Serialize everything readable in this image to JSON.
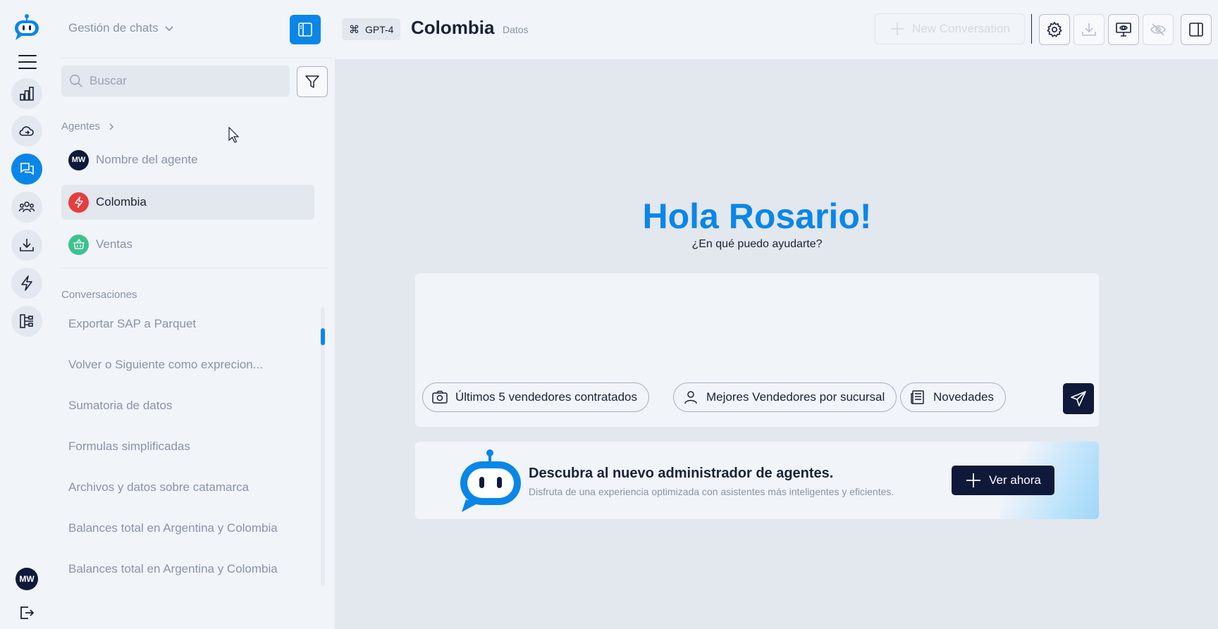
{
  "rail": {
    "avatar_initials": "MW",
    "icons": [
      "dashboard-icon",
      "cloud-sync-icon",
      "chats-icon",
      "team-icon",
      "download-icon",
      "lightning-icon",
      "workflow-icon"
    ]
  },
  "sidebar": {
    "title": "Gestión de chats",
    "search_placeholder": "Buscar",
    "agents_label": "Agentes",
    "agents": [
      {
        "name": "Nombre del agente",
        "initials": "MW",
        "color": "#0f1a3a"
      },
      {
        "name": "Colombia",
        "color": "#e53e3e"
      },
      {
        "name": "Ventas",
        "color": "#3ec28f"
      }
    ],
    "conversations_label": "Conversaciones",
    "conversations": [
      "Exportar SAP a Parquet",
      "Volver o Siguiente como exprecion...",
      "Sumatoria de datos",
      "Formulas simplificadas",
      "Archivos y datos sobre catamarca",
      "Balances total en Argentina y Colombia",
      "Balances total en Argentina y Colombia"
    ]
  },
  "topbar": {
    "model": "GPT-4",
    "agent_title": "Colombia",
    "agent_subtitle": "Datos",
    "new_conversation": "New Conversation"
  },
  "main": {
    "greeting": "Hola Rosario!",
    "subtitle": "¿En qué puedo ayudarte?",
    "composer_value": "",
    "chips": [
      "Últimos 5  vendedores contratados",
      "Mejores  Vendedores por sucursal",
      "Novedades"
    ],
    "banner": {
      "title": "Descubra al nuevo administrador de agentes.",
      "text": "Disfruta de una experiencia optimizada con asistentes más inteligentes y eficientes.",
      "button": "Ver ahora"
    }
  },
  "colors": {
    "accent": "#0a86e8",
    "dark": "#0f1a3a",
    "muted": "#8a93a6",
    "background": "#f1f4f9",
    "main_background": "#e3e7ee"
  }
}
